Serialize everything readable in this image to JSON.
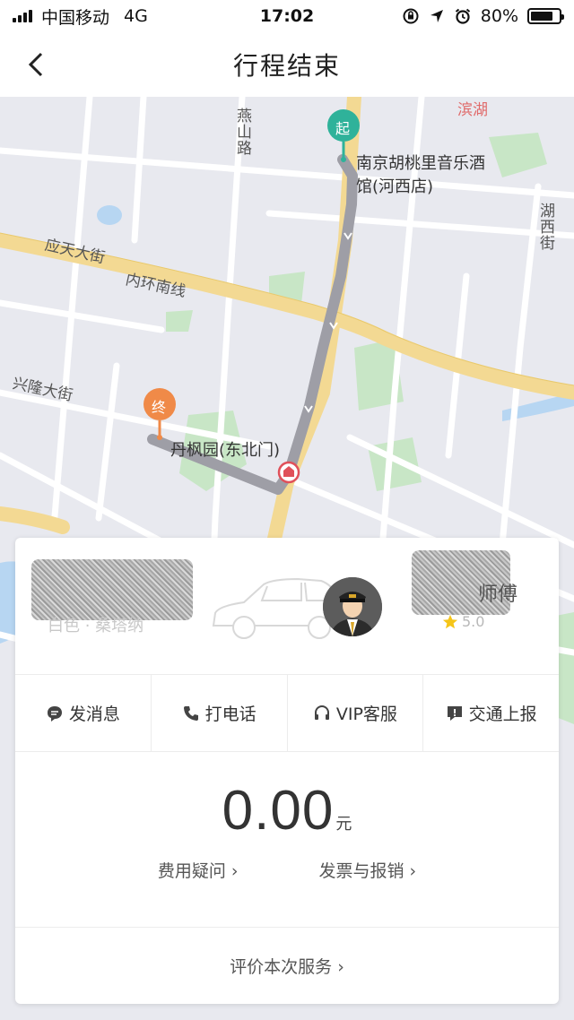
{
  "status_bar": {
    "carrier": "中国移动",
    "network": "4G",
    "time": "17:02",
    "battery_percent": "80%",
    "battery_level": 0.8
  },
  "nav": {
    "title": "行程结束",
    "back_icon": "chevron-left-icon"
  },
  "map": {
    "start_marker": "起",
    "end_marker": "终",
    "start_name": "南京胡桃里音乐酒馆(河西店)",
    "end_name": "丹枫园(东北门)",
    "roads": {
      "yingtian": "应天大街",
      "neihuan": "内环南线",
      "xinglong": "兴隆大街",
      "yanshan": "燕山路",
      "huxi": "湖西街",
      "binhu": "滨湖"
    },
    "colors": {
      "route": "#9e9ea6",
      "start": "#2fb29a",
      "end": "#f08a48",
      "main_road": "#f3d993"
    }
  },
  "card": {
    "driver_name_suffix": "师傅",
    "rating": "5.0",
    "plate_hint": "白色 · 桑塔纳",
    "actions": [
      {
        "label": "发消息",
        "icon": "message-icon"
      },
      {
        "label": "打电话",
        "icon": "phone-icon"
      },
      {
        "label": "VIP客服",
        "icon": "headset-icon"
      },
      {
        "label": "交通上报",
        "icon": "report-icon"
      }
    ],
    "fare": {
      "amount": "0.00",
      "unit": "元",
      "question_link": "费用疑问 ›",
      "invoice_link": "发票与报销 ›"
    },
    "rate_service": "评价本次服务 ›"
  }
}
